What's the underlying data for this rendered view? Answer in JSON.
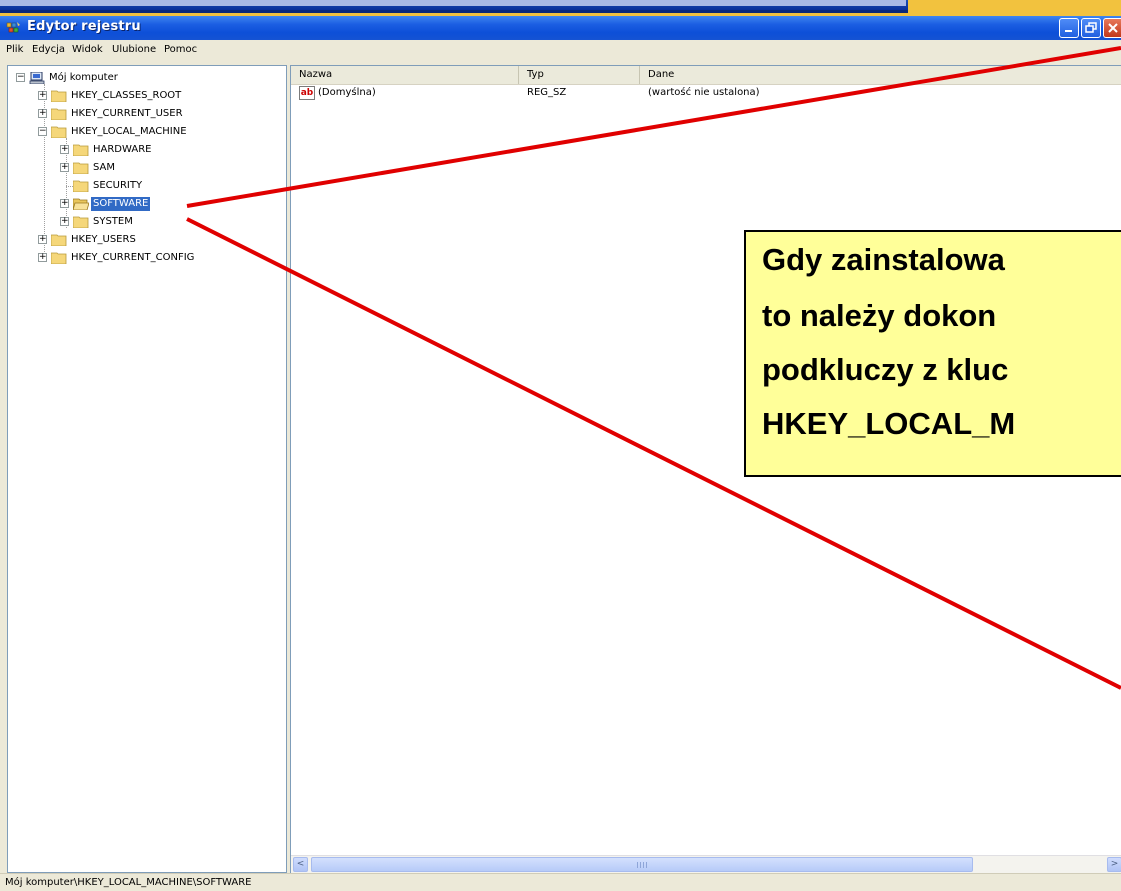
{
  "window": {
    "title": "Edytor rejestru",
    "icon": "regedit-icon"
  },
  "menu": [
    "Plik",
    "Edycja",
    "Widok",
    "Ulubione",
    "Pomoc"
  ],
  "tree": {
    "root": "Mój komputer",
    "hives": [
      {
        "label": "HKEY_CLASSES_ROOT",
        "expand": "+"
      },
      {
        "label": "HKEY_CURRENT_USER",
        "expand": "+"
      },
      {
        "label": "HKEY_LOCAL_MACHINE",
        "expand": "-"
      },
      {
        "label": "HKEY_USERS",
        "expand": "+"
      },
      {
        "label": "HKEY_CURRENT_CONFIG",
        "expand": "+"
      }
    ],
    "local_machine_children": [
      {
        "label": "HARDWARE",
        "expand": "+"
      },
      {
        "label": "SAM",
        "expand": "+"
      },
      {
        "label": "SECURITY",
        "expand": ""
      },
      {
        "label": "SOFTWARE",
        "expand": "+",
        "selected": true
      },
      {
        "label": "SYSTEM",
        "expand": "+"
      }
    ]
  },
  "list": {
    "columns": [
      "Nazwa",
      "Typ",
      "Dane"
    ],
    "rows": [
      {
        "name": "(Domyślna)",
        "type": "REG_SZ",
        "data": "(wartość nie ustalona)",
        "icon": "string-value-icon"
      }
    ]
  },
  "status": {
    "path": "Mój komputer\\HKEY_LOCAL_MACHINE\\SOFTWARE"
  },
  "note": {
    "lines": [
      "Gdy zainstalowa",
      "to należy dokon",
      "podkluczy z kluc",
      "HKEY_LOCAL_M"
    ]
  },
  "colors": {
    "titlebar": "#0d4fd8",
    "selection": "#316ac5",
    "annotation_fill": "#ffff99",
    "arrow": "#e00000",
    "background": "#f4c84a"
  }
}
